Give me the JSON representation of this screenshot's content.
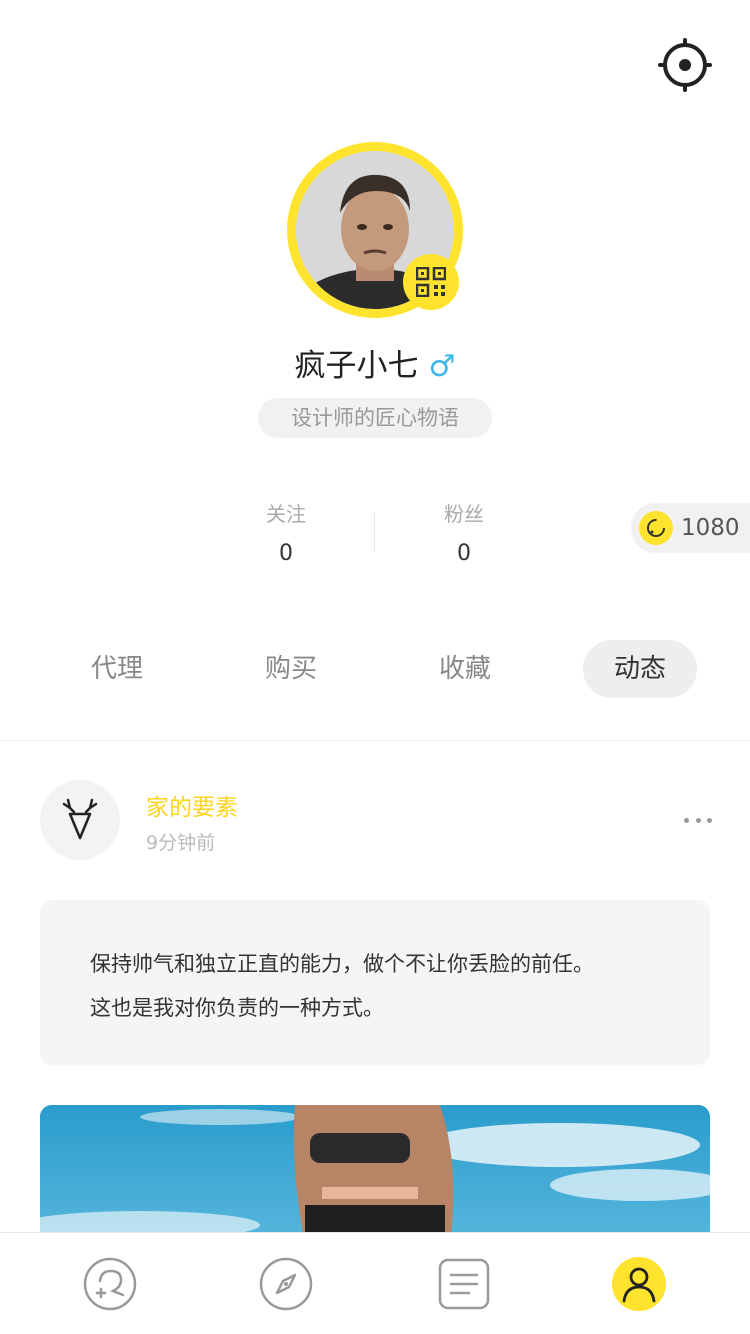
{
  "profile": {
    "name": "疯子小七",
    "gender_symbol": "♂",
    "motto": "设计师的匠心物语"
  },
  "stats": {
    "following_label": "关注",
    "following_value": "0",
    "followers_label": "粉丝",
    "followers_value": "0"
  },
  "coins": {
    "amount": "1080"
  },
  "tabs": [
    {
      "label": "代理"
    },
    {
      "label": "购买"
    },
    {
      "label": "收藏"
    },
    {
      "label": "动态",
      "active": true
    }
  ],
  "post": {
    "title": "家的要素",
    "time": "9分钟前",
    "text_line1": "保持帅气和独立正直的能力，做个不让你丢脸的前任。",
    "text_line2": "这也是我对你负责的一种方式。"
  },
  "nav": [
    "chat-plus-icon",
    "compass-icon",
    "list-icon",
    "user-icon"
  ],
  "colors": {
    "accent": "#ffe32c",
    "gender": "#3bb8e8"
  }
}
